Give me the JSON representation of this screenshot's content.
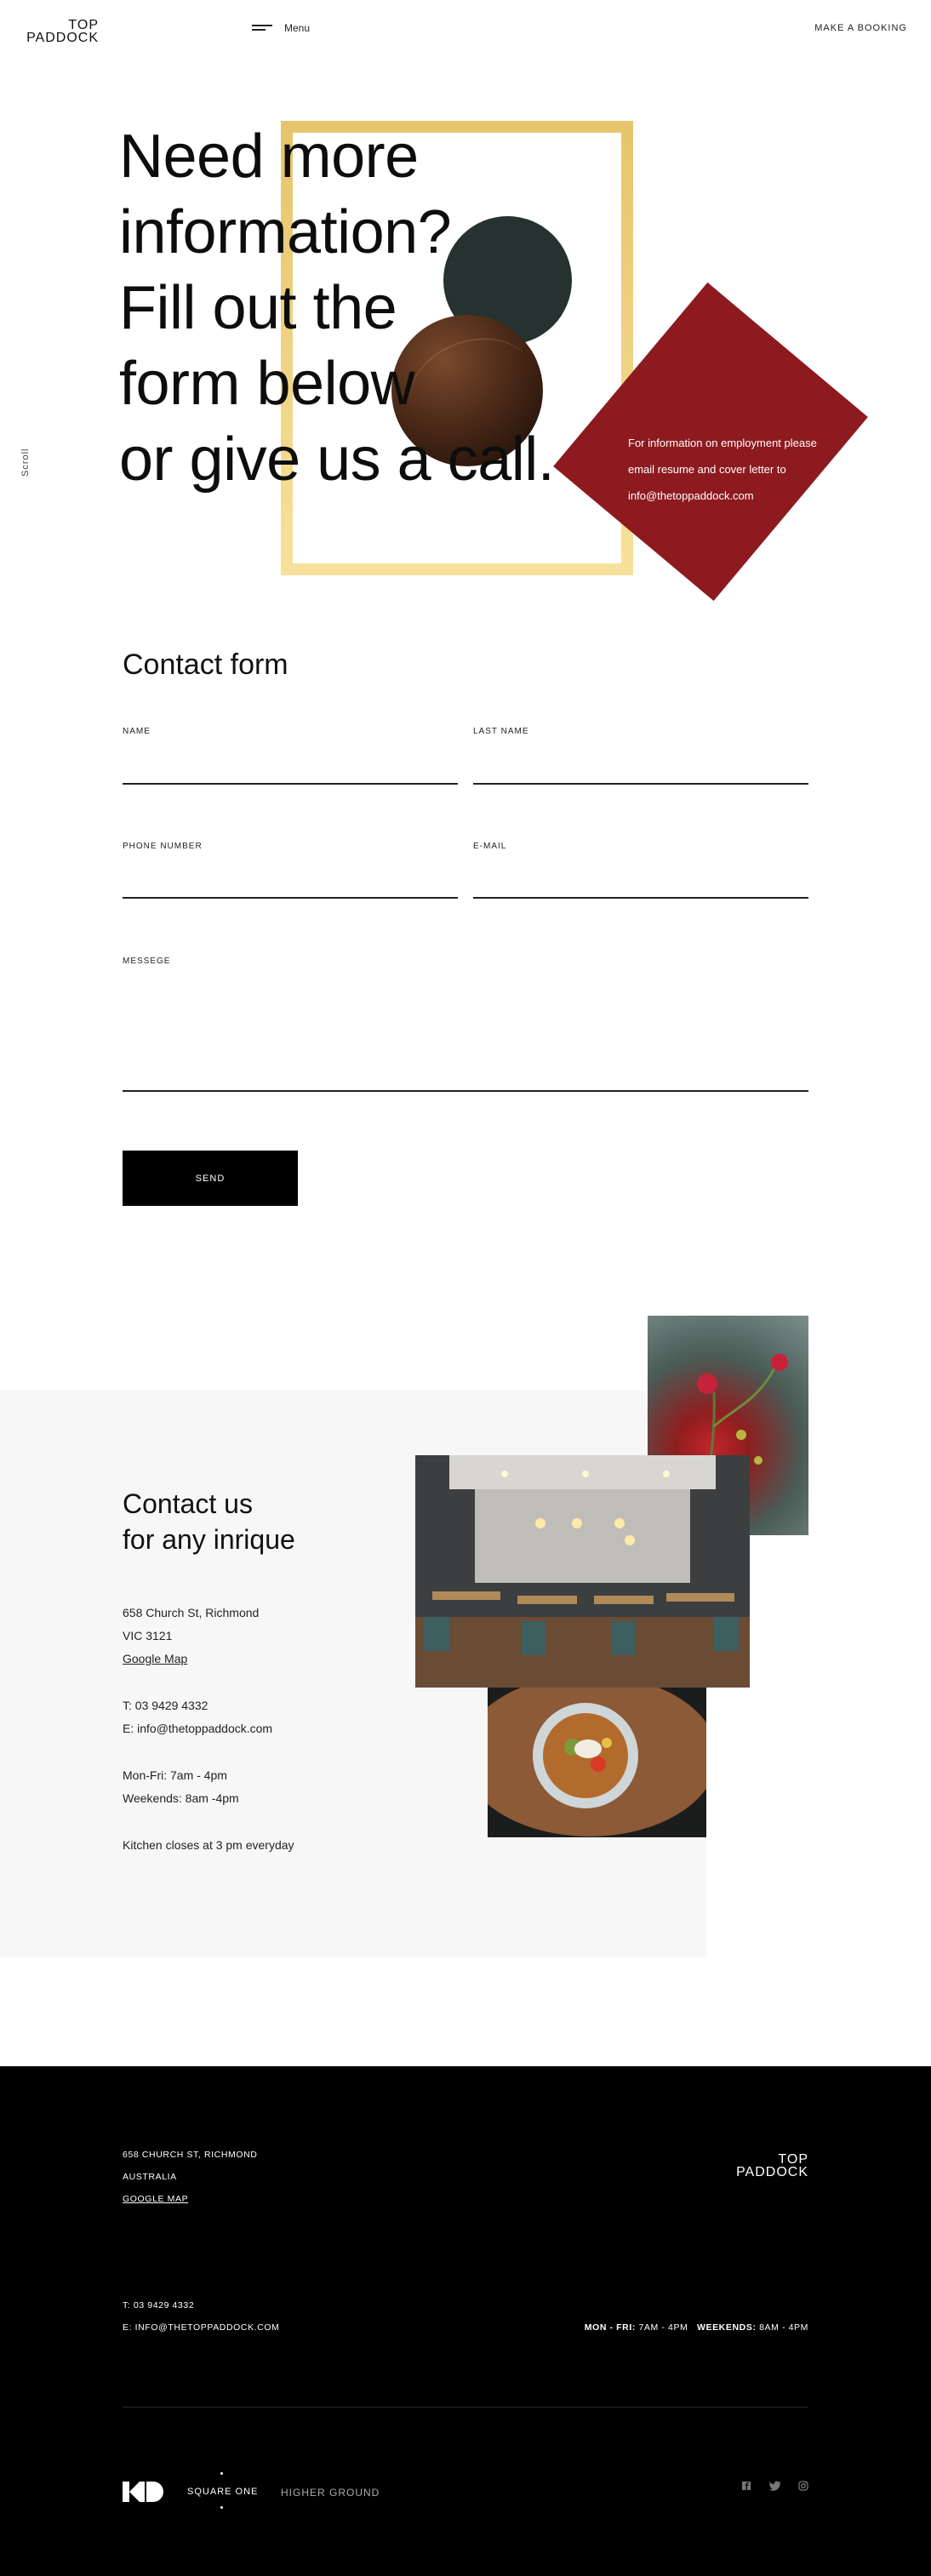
{
  "header": {
    "logo_line1": "TOP",
    "logo_line2": "PADDOCK",
    "menu_label": "Menu",
    "booking_label": "MAKE A BOOKING"
  },
  "scroll_label": "Scroll",
  "hero": {
    "title_lines": [
      "Need more",
      "information?",
      "Fill out the",
      "form below",
      "or give us a call."
    ],
    "employment_text": "For information on employment please email resume and cover letter to info@thetoppaddock.com",
    "colors": {
      "gold": "#ecc96a",
      "dark_circle": "#253230",
      "red": "#8d1a1f"
    }
  },
  "form": {
    "title": "Contact form",
    "name_label": "NAME",
    "last_name_label": "LAST NAME",
    "phone_label": "PHONE NUMBER",
    "email_label": "E-MAIL",
    "message_label": "MESSEGE",
    "send_label": "SEND"
  },
  "contact": {
    "title_line1": "Contact us",
    "title_line2": "for any inrique",
    "address_line1": "658 Church St, Richmond",
    "address_line2": "VIC 3121",
    "map_link": "Google Map",
    "phone": "T: 03 9429 4332",
    "email": "E: info@thetoppaddock.com",
    "hours_weekdays": "Mon-Fri: 7am - 4pm",
    "hours_weekends": "Weekends: 8am -4pm",
    "kitchen_note": "Kitchen closes at 3 pm everyday"
  },
  "footer": {
    "address_line1": "658 CHURCH ST, RICHMOND",
    "address_line2": "AUSTRALIA",
    "map_link": "GOOGLE MAP",
    "logo_line1": "TOP",
    "logo_line2": "PADDOCK",
    "phone": "T: 03 9429 4332",
    "email": "E: INFO@THETOPPADDOCK.COM",
    "hours_weekdays_label": "MON - FRI:",
    "hours_weekdays_value": "7AM - 4PM",
    "hours_weekends_label": "WEEKENDS:",
    "hours_weekends_value": "8AM - 4PM",
    "partner_logo_1": "KD",
    "partner_square_one": "SQUARE ONE",
    "partner_higher_ground": "HIGHER GROUND",
    "social_icons": [
      "facebook-icon",
      "twitter-icon",
      "instagram-icon"
    ]
  }
}
